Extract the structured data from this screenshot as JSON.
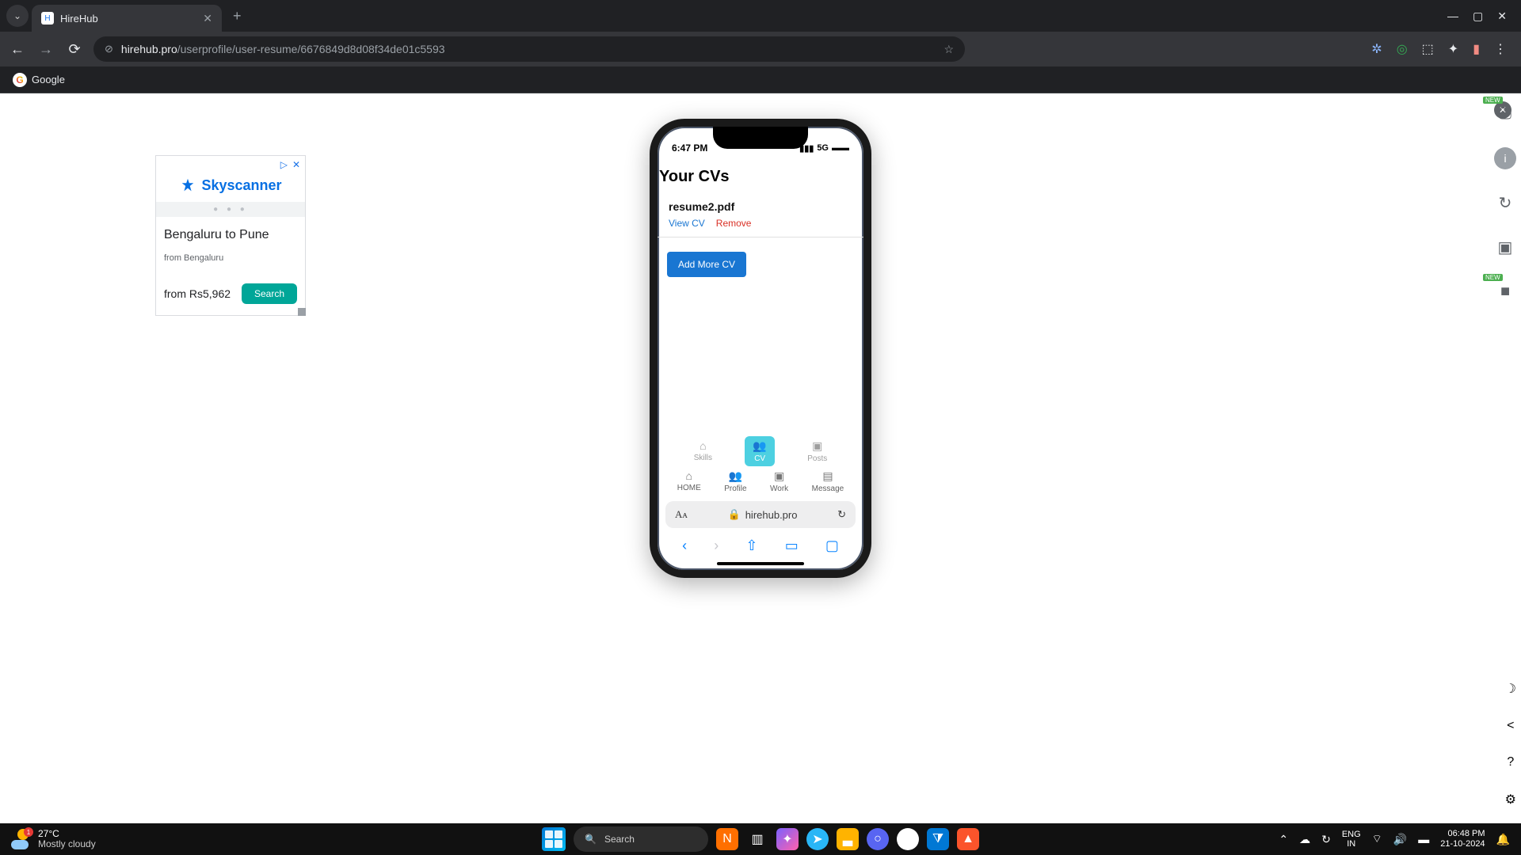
{
  "browser": {
    "tab_title": "HireHub",
    "url_host": "hirehub.pro",
    "url_path": "/userprofile/user-resume/6676849d8d08f34de01c5593",
    "bookmark_google": "Google"
  },
  "ad": {
    "brand": "Skyscanner",
    "route": "Bengaluru to Pune",
    "from_label": "from Bengaluru",
    "price": "from Rs5,962",
    "search": "Search"
  },
  "phone": {
    "status_time": "6:47 PM",
    "status_net": "5G",
    "title": "Your CVs",
    "cv_filename": "resume2.pdf",
    "view_label": "View CV",
    "remove_label": "Remove",
    "add_label": "Add More CV",
    "tabs": {
      "skills": "Skills",
      "cv": "CV",
      "posts": "Posts"
    },
    "nav": {
      "home": "HOME",
      "profile": "Profile",
      "work": "Work",
      "message": "Message"
    },
    "safari_host": "hirehub.pro"
  },
  "taskbar": {
    "temp": "27°C",
    "weather": "Mostly cloudy",
    "weather_badge": "1",
    "search_placeholder": "Search",
    "lang_top": "ENG",
    "lang_bottom": "IN",
    "time": "06:48 PM",
    "date": "21-10-2024"
  }
}
